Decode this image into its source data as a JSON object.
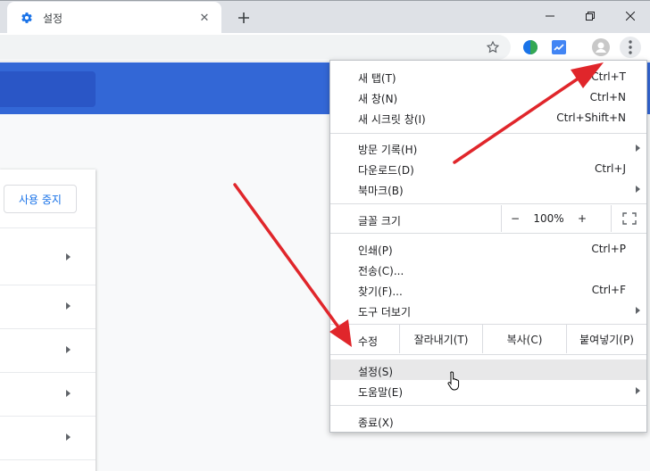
{
  "window": {
    "tab_title": "설정",
    "tab_close": "✕",
    "new_tab": "+"
  },
  "page": {
    "stop_button": "사용 중지"
  },
  "menu": {
    "new_tab": {
      "label": "새 탭(T)",
      "shortcut": "Ctrl+T"
    },
    "new_window": {
      "label": "새 창(N)",
      "shortcut": "Ctrl+N"
    },
    "incognito": {
      "label": "새 시크릿 창(I)",
      "shortcut": "Ctrl+Shift+N"
    },
    "history": {
      "label": "방문 기록(H)"
    },
    "downloads": {
      "label": "다운로드(D)",
      "shortcut": "Ctrl+J"
    },
    "bookmarks": {
      "label": "북마크(B)"
    },
    "zoom": {
      "label": "글꼴 크기",
      "minus": "−",
      "value": "100%",
      "plus": "+"
    },
    "print": {
      "label": "인쇄(P)",
      "shortcut": "Ctrl+P"
    },
    "cast": {
      "label": "전송(C)..."
    },
    "find": {
      "label": "찾기(F)...",
      "shortcut": "Ctrl+F"
    },
    "more_tools": {
      "label": "도구 더보기"
    },
    "edit": {
      "label": "수정",
      "cut": "잘라내기(T)",
      "copy": "복사(C)",
      "paste": "붙여넣기(P)"
    },
    "settings": {
      "label": "설정(S)"
    },
    "help": {
      "label": "도움말(E)"
    },
    "exit": {
      "label": "종료(X)"
    }
  },
  "colors": {
    "header_blue": "#3367d6",
    "accent_blue": "#1a73e8",
    "arrow_red": "#e0262b"
  },
  "icons": [
    "settings-gear-icon",
    "close-icon",
    "plus-icon",
    "minimize-icon",
    "restore-icon",
    "window-close-icon",
    "star-icon",
    "extension-icon",
    "chart-extension-icon",
    "profile-avatar-icon",
    "more-vert-icon",
    "fullscreen-icon",
    "mouse-pointer-icon"
  ]
}
